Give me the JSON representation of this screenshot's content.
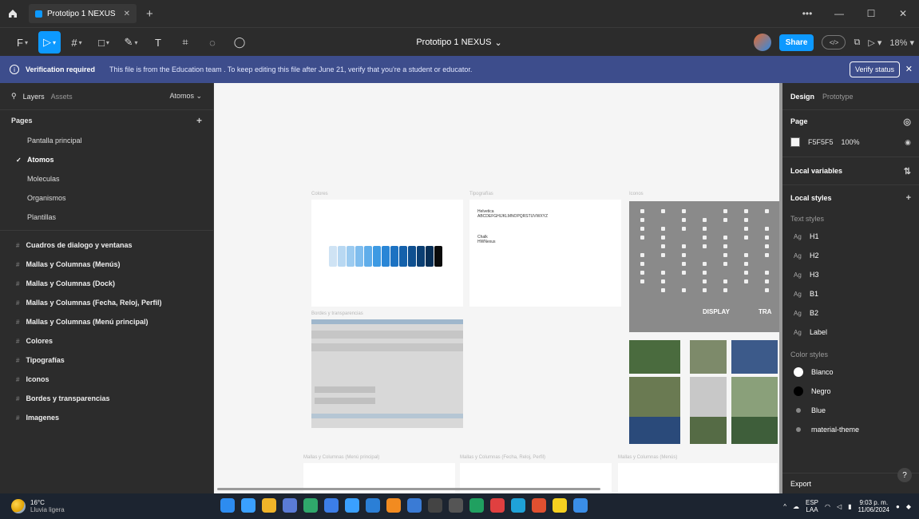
{
  "window": {
    "tab_title": "Prototipo 1 NEXUS",
    "file_title": "Prototipo 1 NEXUS"
  },
  "toolbar": {
    "share_label": "Share",
    "zoom_label": "18%",
    "dev_label": "</>"
  },
  "banner": {
    "title": "Verification required",
    "message": "This file is from the Education team . To keep editing this file after June 21, verify that you're a student or educator.",
    "button": "Verify status"
  },
  "left_panel": {
    "tab_layers": "Layers",
    "tab_assets": "Assets",
    "page_selector": "Atomos",
    "pages_title": "Pages",
    "pages": [
      "Pantalla principal",
      "Atomos",
      "Moleculas",
      "Organismos",
      "Plantillas"
    ],
    "current_page_index": 1,
    "layers": [
      "Cuadros de dialogo y ventanas",
      "Mallas y Columnas (Menús)",
      "Mallas y Columnas (Dock)",
      "Mallas y Columnas (Fecha, Reloj, Perfil)",
      "Mallas y Columnas (Menú principal)",
      "Colores",
      "Tipografías",
      "Iconos",
      "Bordes y transparencias",
      "Imagenes"
    ]
  },
  "canvas": {
    "frame_labels": {
      "colores": "Colores",
      "tipografias": "Tipografías",
      "iconos": "Iconos",
      "bordes": "Bordes y transparencias",
      "malla_menu": "Mallas y Columnas (Menú principal)",
      "malla_fecha": "Mallas y Columnas (Fecha, Reloj, Perfil)",
      "malla_menus": "Mallas y Columnas (Menús)"
    },
    "typo_text": {
      "font1": "Helvetica",
      "sample": "ABCDEFGHIJKLMNOPQRSTUVWXYZ",
      "font2": "Chalk",
      "font3": "HWNexus"
    },
    "icons_text": {
      "display": "DISPLAY",
      "tra": "TRA"
    },
    "swatch_colors": [
      "#cfe3f4",
      "#b8d8f2",
      "#9ccbf0",
      "#7fbdee",
      "#5fadea",
      "#3d9ae3",
      "#2a86d6",
      "#1c72c2",
      "#1461ab",
      "#0f5090",
      "#0b3f73",
      "#072e55",
      "#0a0a0a"
    ]
  },
  "right_panel": {
    "tab_design": "Design",
    "tab_prototype": "Prototype",
    "page_title": "Page",
    "page_color": "F5F5F5",
    "page_opacity": "100%",
    "local_variables": "Local variables",
    "local_styles": "Local styles",
    "text_styles_title": "Text styles",
    "text_styles": [
      "H1",
      "H2",
      "H3",
      "B1",
      "B2",
      "Label"
    ],
    "color_styles_title": "Color styles",
    "color_styles": [
      {
        "name": "Blanco",
        "color": "#ffffff"
      },
      {
        "name": "Negro",
        "color": "#000000"
      },
      {
        "name": "Blue",
        "color": "#2c2c2c"
      },
      {
        "name": "material-theme",
        "color": "#2c2c2c"
      }
    ],
    "export": "Export"
  },
  "taskbar": {
    "temperature": "16°C",
    "weather": "Lluvia ligera",
    "lang_top": "ESP",
    "lang_bottom": "LAA",
    "time": "9:03 p. m.",
    "date": "11/06/2024"
  }
}
